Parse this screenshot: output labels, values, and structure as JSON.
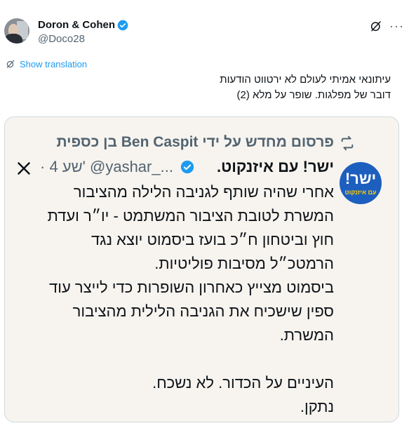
{
  "author": {
    "name": "Doron & Cohen",
    "handle": "@Doco28"
  },
  "translate_label": "Show translation",
  "tweet_lines": [
    "עיתונאי אמיתי לעולם לא ירטווט הודעות",
    "דובר של מפלגות. שופר על מלא (2)"
  ],
  "quoted": {
    "repost_label": "פרסום מחדש על ידי Ben Caspit בן כספית",
    "poster_name": "ישר! עם איזנקוט.",
    "poster_handle": "@yashar_...",
    "time": "· 4 שע'",
    "logo_top": "ישר!",
    "logo_bottom": "עם איזנקוט",
    "text": "אחרי שהיה שותף לגניבה הלילה מהציבור\nהמשרת לטובת הציבור המשתמט - יו״ר ועדת\nחוץ וביטחון ח״כ בועז ביסמוט יוצא נגד\nהרמטכ״ל מסיבות פוליטיות.\nביסמוט מצייץ כאחרון השופרות כדי לייצר עוד\nספין שישכיח את הגניבה הלילית מהציבור\nהמשרת.\n\nהעיניים על הכדור. לא נשכח.\nנתקן."
  },
  "colors": {
    "accent": "#1d9bf0",
    "quote_bg": "#f7f4ef",
    "logo_bg": "#1d5fbf"
  },
  "icons": [
    "verified-badge-icon",
    "grok-icon",
    "more-icon",
    "translate-icon",
    "repost-icon",
    "x-logo-icon"
  ]
}
